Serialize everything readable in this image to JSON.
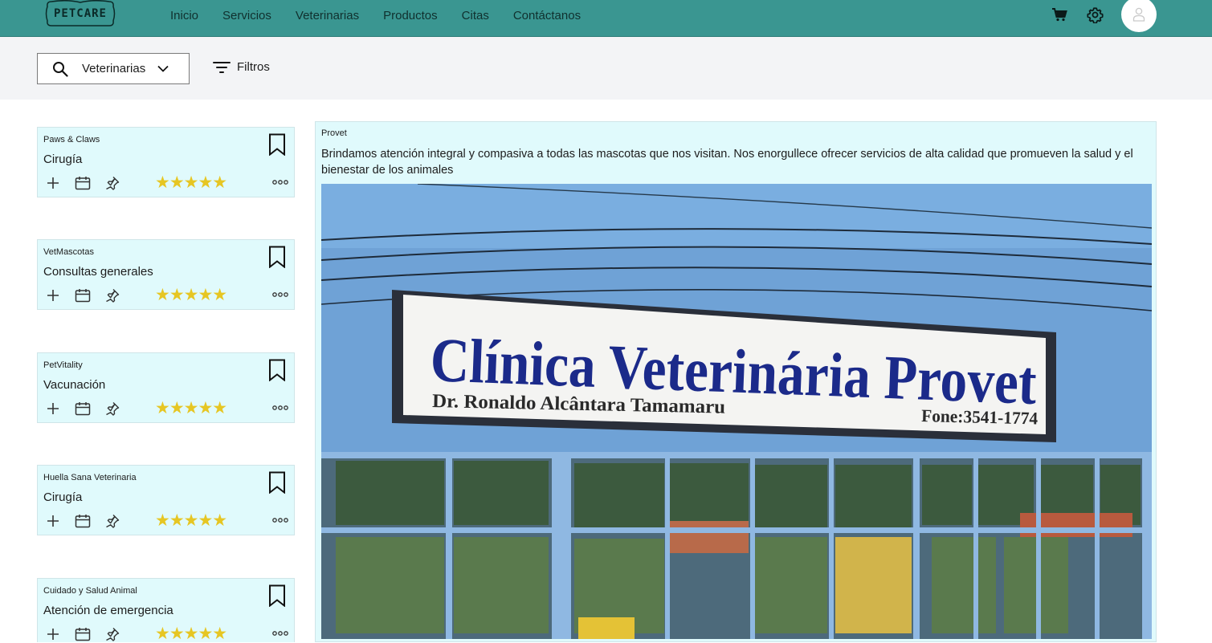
{
  "brand": {
    "logo_text": "PETCARE"
  },
  "nav": {
    "links": [
      "Inicio",
      "Servicios",
      "Veterinarias",
      "Productos",
      "Citas",
      "Contáctanos"
    ],
    "icons": [
      "cart-icon",
      "gear-icon",
      "user-avatar-icon"
    ]
  },
  "search": {
    "selected": "Veterinarias",
    "filters_label": "Filtros"
  },
  "cards": [
    {
      "name": "Paws & Claws",
      "service": "Cirugía",
      "rating": 5
    },
    {
      "name": "VetMascotas",
      "service": "Consultas generales",
      "rating": 5
    },
    {
      "name": "PetVitality",
      "service": "Vacunación",
      "rating": 5
    },
    {
      "name": "Huella Sana Veterinaria",
      "service": "Cirugía",
      "rating": 5
    },
    {
      "name": "Cuidado y Salud Animal",
      "service": "Atención de emergencia",
      "rating": 5
    }
  ],
  "detail": {
    "name": "Provet",
    "description": "Brindamos atención integral y compasiva a todas las mascotas que nos visitan. Nos enorgullece ofrecer servicios de alta calidad que promueven la salud y el bienestar de los animales",
    "photo": {
      "sign_title": "Clínica Veterinária Provet",
      "sign_subtitle": "Dr. Ronaldo Alcântara Tamamaru",
      "sign_phone": "Fone:3541-1774"
    }
  },
  "colors": {
    "navbar": "#3a9691",
    "card_bg": "#e0fafc",
    "star": "#e6c623",
    "wall": "#6fa2d6",
    "sign_text": "#1b2a8a"
  }
}
